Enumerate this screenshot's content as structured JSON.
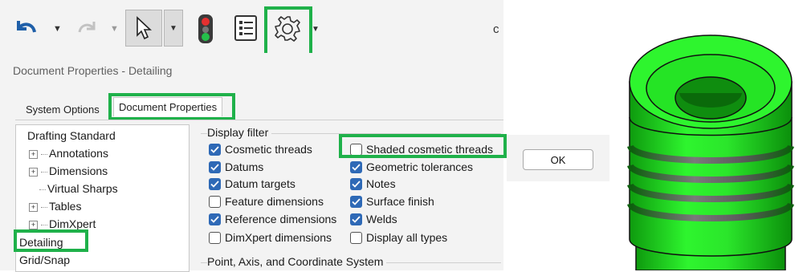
{
  "toolbar": {
    "icons": [
      "undo-icon",
      "dropdown-arrow",
      "redo-icon",
      "dropdown-arrow",
      "select-pointer-icon",
      "dropdown-arrow",
      "traffic-light-icon",
      "properties-list-icon",
      "gear-icon",
      "dropdown-arrow"
    ],
    "partial_text": "c"
  },
  "dialog": {
    "title": "Document Properties - Detailing",
    "tabs": [
      {
        "label": "System Options",
        "active": false
      },
      {
        "label": "Document Properties",
        "active": true
      }
    ],
    "tree": [
      {
        "label": "Drafting Standard",
        "level": 0,
        "expander": false
      },
      {
        "label": "Annotations",
        "level": 1,
        "expander": true
      },
      {
        "label": "Dimensions",
        "level": 1,
        "expander": true
      },
      {
        "label": "Virtual Sharps",
        "level": 1,
        "expander": false
      },
      {
        "label": "Tables",
        "level": 1,
        "expander": true
      },
      {
        "label": "DimXpert",
        "level": 1,
        "expander": true
      },
      {
        "label": "Detailing",
        "level": 0,
        "expander": false,
        "selected": true
      },
      {
        "label": "Grid/Snap",
        "level": 0,
        "expander": false
      }
    ],
    "display_filter": {
      "title": "Display filter",
      "left": [
        {
          "label": "Cosmetic threads",
          "checked": true
        },
        {
          "label": "Datums",
          "checked": true
        },
        {
          "label": "Datum targets",
          "checked": true
        },
        {
          "label": "Feature dimensions",
          "checked": false
        },
        {
          "label": "Reference dimensions",
          "checked": true
        },
        {
          "label": "DimXpert dimensions",
          "checked": false
        }
      ],
      "right": [
        {
          "label": "Shaded cosmetic threads",
          "checked": false
        },
        {
          "label": "Geometric tolerances",
          "checked": true
        },
        {
          "label": "Notes",
          "checked": true
        },
        {
          "label": "Surface finish",
          "checked": true
        },
        {
          "label": "Welds",
          "checked": true
        },
        {
          "label": "Display all types",
          "checked": false
        }
      ]
    },
    "next_group_title": "Point, Axis, and Coordinate System",
    "ok_label": "OK"
  },
  "colors": {
    "highlight": "#1fb14a",
    "checkbox_on": "#2e69b6",
    "part_green": "#22dd22"
  }
}
